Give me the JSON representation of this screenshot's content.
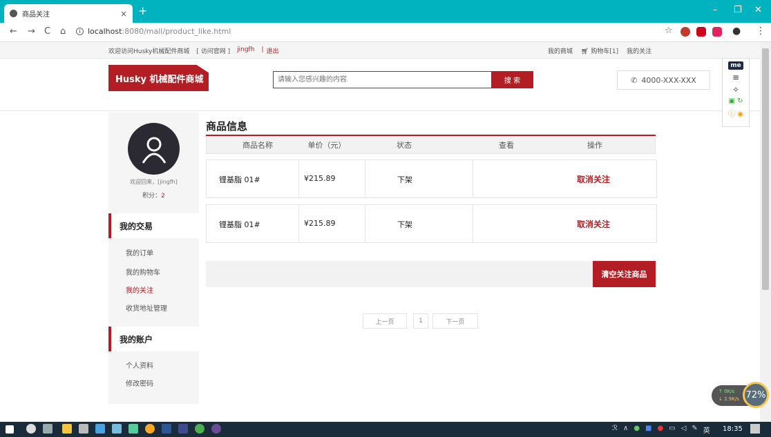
{
  "browser": {
    "tab_title": "商品关注",
    "tab_close": "×",
    "new_tab": "+",
    "back": "←",
    "forward": "→",
    "reload": "C",
    "home": "⌂",
    "url_host": "localhost",
    "url_rest": ":8080/mall/product_like.html",
    "window_min": "–",
    "window_max": "❐",
    "window_close": "✕"
  },
  "site_top": {
    "welcome": "欢迎访问Husky机械配件商城",
    "visit_official": "[ 访问官网 ]",
    "username": "jingfh",
    "sep": "|",
    "logout": "退出",
    "my_mall": "我的商城",
    "cart": "购物车[1]",
    "my_follow": "我的关注"
  },
  "header": {
    "logo": "Husky 机械配件商城",
    "search_placeholder": "请输入您感兴趣的内容",
    "search_button": "搜 索",
    "phone": "4000-XXX-XXX"
  },
  "sidebar": {
    "welcome_user": "欢迎回来，[jingfh]",
    "points_label": "积分：",
    "points_value": "2",
    "section1_title": "我的交易",
    "section1_items": [
      "我的订单",
      "我的购物车",
      "我的关注",
      "收货地址管理"
    ],
    "section2_title": "我的账户",
    "section2_items": [
      "个人资料",
      "修改密码"
    ]
  },
  "main": {
    "title": "商品信息",
    "columns": [
      "商品名称",
      "单价（元）",
      "状态",
      "查看",
      "操作"
    ],
    "rows": [
      {
        "name": "锂基脂 01#",
        "price": "¥215.89",
        "status": "下架",
        "action": "取消关注"
      },
      {
        "name": "锂基脂 01#",
        "price": "¥215.89",
        "status": "下架",
        "action": "取消关注"
      }
    ],
    "clear_button": "清空关注商品",
    "pagination": {
      "prev": "上一页",
      "page": "1",
      "next": "下一页"
    }
  },
  "widgets": {
    "net_up": "↑ 0K/s",
    "net_down": "↓ 2.9K/s",
    "cpu": "72%"
  },
  "taskbar": {
    "clock": "18:35",
    "ime": "英"
  }
}
